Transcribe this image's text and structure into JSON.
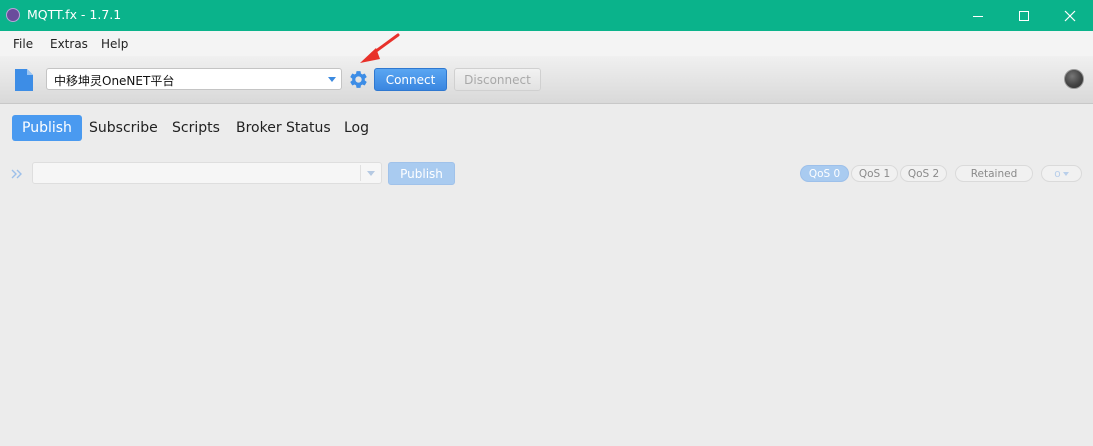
{
  "window": {
    "title": "MQTT.fx - 1.7.1"
  },
  "menu": {
    "items": [
      "File",
      "Extras",
      "Help"
    ]
  },
  "toolbar": {
    "profile_value": "中移坤灵OneNET平台",
    "connect_label": "Connect",
    "disconnect_label": "Disconnect"
  },
  "tabs": {
    "items": [
      "Publish",
      "Subscribe",
      "Scripts",
      "Broker Status",
      "Log"
    ],
    "active": "Publish"
  },
  "publish": {
    "topic_value": "",
    "publish_label": "Publish",
    "qos": [
      "QoS 0",
      "QoS 1",
      "QoS 2"
    ],
    "qos_selected": "QoS 0",
    "retained_label": "Retained",
    "options_label": "o"
  },
  "colors": {
    "titlebar": "#0ab38b",
    "accent": "#4a9af0",
    "annotation_arrow": "#e8312a"
  }
}
